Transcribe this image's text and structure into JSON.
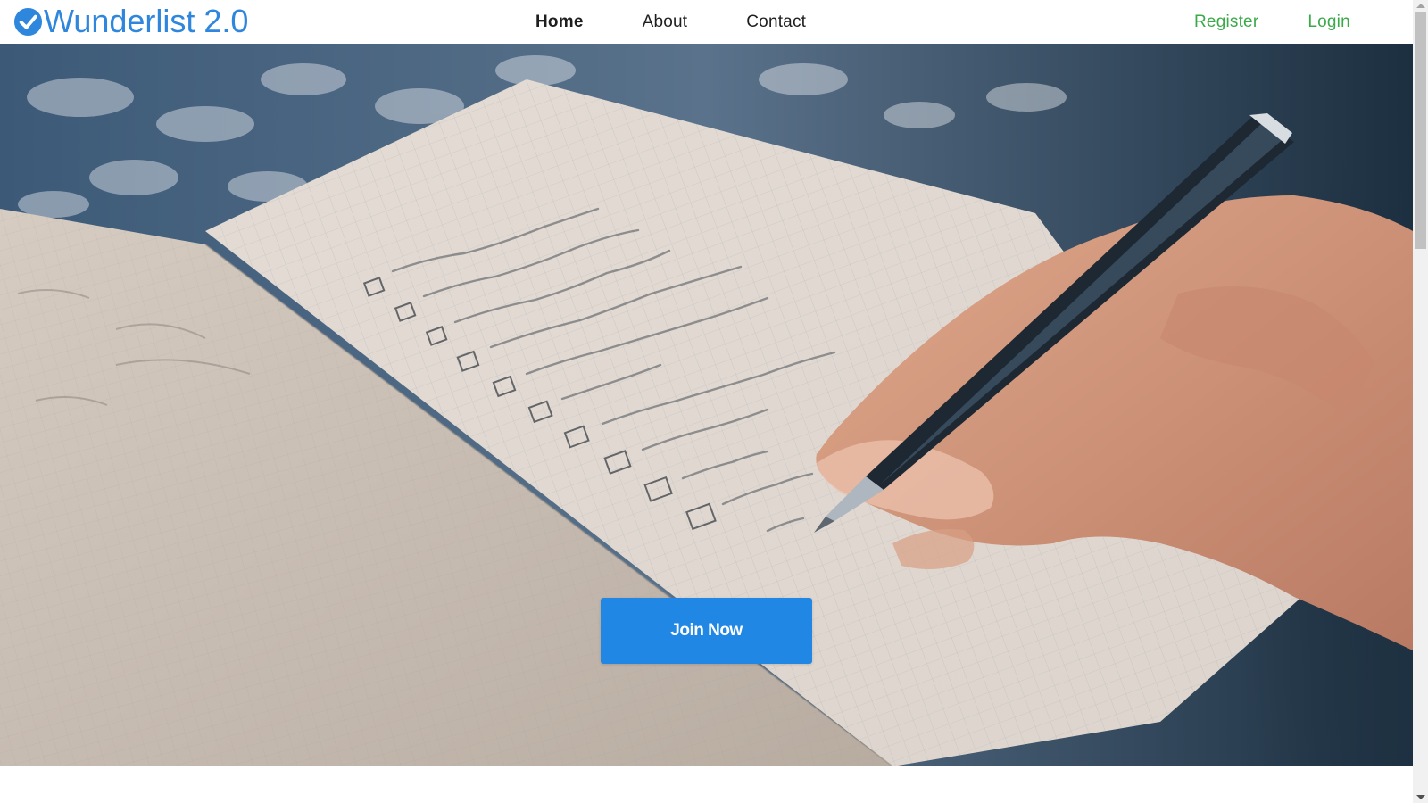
{
  "brand": {
    "title": "Wunderlist 2.0",
    "icon": "check-circle-icon",
    "color": "#2f86dd"
  },
  "nav": {
    "links": [
      {
        "label": "Home",
        "active": true
      },
      {
        "label": "About",
        "active": false
      },
      {
        "label": "Contact",
        "active": false
      }
    ],
    "auth": {
      "register_label": "Register",
      "login_label": "Login",
      "color": "#3aaa49"
    }
  },
  "hero": {
    "image": "checklist-notebook-hand-writing",
    "cta_label": "Join Now",
    "cta_color": "#2187e4"
  }
}
